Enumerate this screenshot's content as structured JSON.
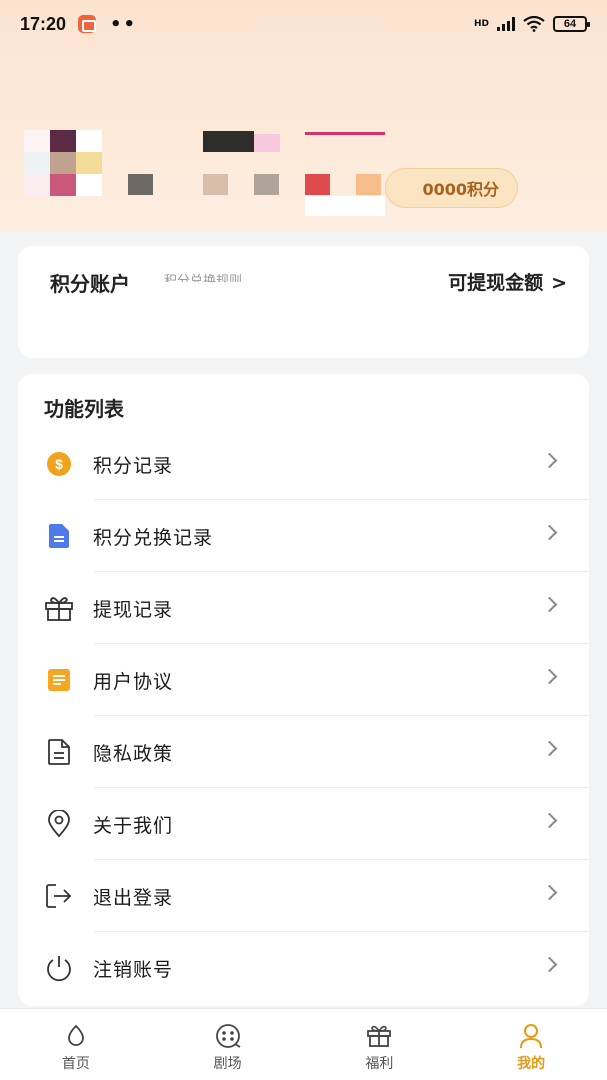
{
  "status_bar": {
    "time": "17:20",
    "dots": "••",
    "network": "HD",
    "battery": "64"
  },
  "profile": {
    "points_pill": "0000积分"
  },
  "account_card": {
    "title": "积分账户",
    "rule_link": "积分兑换规则",
    "withdraw_label": "可提现金额",
    "withdraw_arrow": ">"
  },
  "function_list": {
    "title": "功能列表",
    "items": [
      {
        "label": "积分记录",
        "icon": "coin-icon"
      },
      {
        "label": "积分兑换记录",
        "icon": "document-icon"
      },
      {
        "label": "提现记录",
        "icon": "gift-icon"
      },
      {
        "label": "用户协议",
        "icon": "note-icon"
      },
      {
        "label": "隐私政策",
        "icon": "file-icon"
      },
      {
        "label": "关于我们",
        "icon": "location-icon"
      },
      {
        "label": "退出登录",
        "icon": "logout-icon"
      },
      {
        "label": "注销账号",
        "icon": "power-icon"
      }
    ]
  },
  "tabbar": {
    "tabs": [
      {
        "label": "首页",
        "icon": "home-icon",
        "active": false
      },
      {
        "label": "剧场",
        "icon": "theater-icon",
        "active": false
      },
      {
        "label": "福利",
        "icon": "gift-icon",
        "active": false
      },
      {
        "label": "我的",
        "icon": "user-icon",
        "active": true
      }
    ]
  },
  "colors": {
    "accent": "#e39a16",
    "header_bg": "#fde9d8",
    "coin": "#f0a31c",
    "doc_blue": "#4f7bea",
    "note_orange": "#f5a623"
  }
}
